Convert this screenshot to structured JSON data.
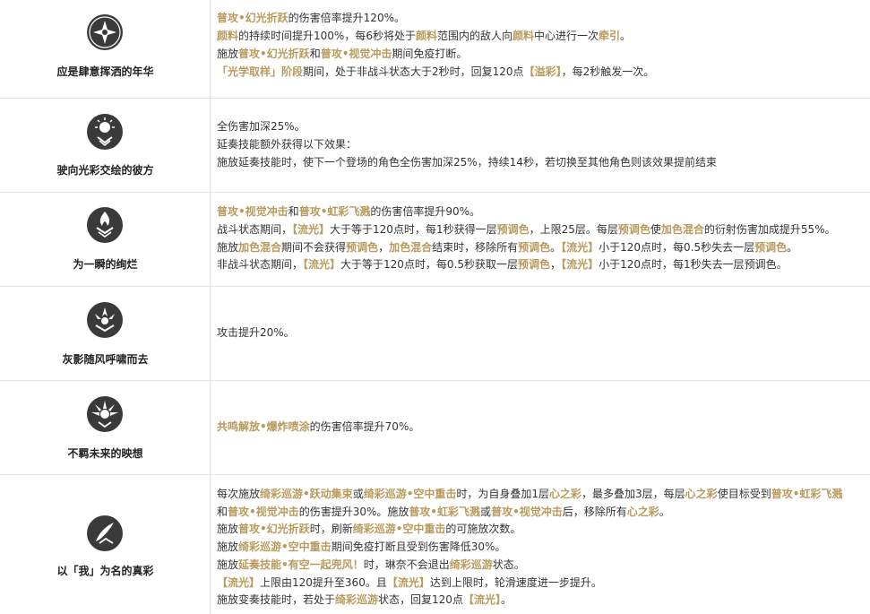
{
  "accent_color": "#b99a5c",
  "rows": [
    {
      "name": "应是肆意挥洒的年华",
      "icon": "radiant-star-icon",
      "lines": [
        [
          [
            "普攻•幻光折跃",
            1
          ],
          [
            "的伤害倍率提升120%。",
            0
          ]
        ],
        [
          [
            "颜料",
            1
          ],
          [
            "的持续时间提升100%，每6秒将处于",
            0
          ],
          [
            "颜料",
            1
          ],
          [
            "范围内的敌人向",
            0
          ],
          [
            "颜料",
            1
          ],
          [
            "中心进行一次",
            0
          ],
          [
            "牵引",
            1
          ],
          [
            "。",
            0
          ]
        ],
        [
          [
            "施放",
            0
          ],
          [
            "普攻•幻光折跃",
            1
          ],
          [
            "和",
            0
          ],
          [
            "普攻•视觉冲击",
            1
          ],
          [
            "期间免疫打断。",
            0
          ]
        ],
        [
          [
            "「光学取样」阶段",
            1
          ],
          [
            "期间，处于非战斗状态大于2秒时，回复120点",
            0
          ],
          [
            "【溢彩】",
            1
          ],
          [
            "，每2秒触发一次。",
            0
          ]
        ]
      ]
    },
    {
      "name": "驶向光彩交绘的彼方",
      "icon": "sun-chevron-icon",
      "lines": [
        [
          [
            "全伤害加深25%。",
            0
          ]
        ],
        [
          [
            "延奏技能额外获得以下效果：",
            0
          ]
        ],
        [
          [
            "施放延奏技能时，使下一个登场的角色全伤害加深25%，持续14秒，若切换至其他角色则该效果提前结束",
            0
          ]
        ]
      ]
    },
    {
      "name": "为一瞬的绚烂",
      "icon": "flame-chevron-icon",
      "lines": [
        [
          [
            "普攻•视觉冲击",
            1
          ],
          [
            "和",
            0
          ],
          [
            "普攻•虹彩飞溅",
            1
          ],
          [
            "的伤害倍率提升90%。",
            0
          ]
        ],
        [
          [
            "战斗状态期间，",
            0
          ],
          [
            "【流光】",
            1
          ],
          [
            "大于等于120点时，每1秒获得一层",
            0
          ],
          [
            "预调色",
            1
          ],
          [
            "，上限25层。每层",
            0
          ],
          [
            "预调色",
            1
          ],
          [
            "使",
            0
          ],
          [
            "加色混合",
            1
          ],
          [
            "的衍射伤害加成提升55%。",
            0
          ]
        ],
        [
          [
            "施放",
            0
          ],
          [
            "加色混合",
            1
          ],
          [
            "期间不会获得",
            0
          ],
          [
            "预调色",
            1
          ],
          [
            "，",
            0
          ],
          [
            "加色混合",
            1
          ],
          [
            "结束时，移除所有",
            0
          ],
          [
            "预调色",
            1
          ],
          [
            "。",
            0
          ],
          [
            "【流光】",
            1
          ],
          [
            "小于120点时，每0.5秒失去一层",
            0
          ],
          [
            "预调色",
            1
          ],
          [
            "。",
            0
          ]
        ],
        [
          [
            "非战斗状态期间，",
            0
          ],
          [
            "【流光】",
            1
          ],
          [
            "大于等于120点时，每0.5秒获取一层",
            0
          ],
          [
            "预调色",
            1
          ],
          [
            "，",
            0
          ],
          [
            "【流光】",
            1
          ],
          [
            "小于120点时，每1秒失去一层预调色。",
            0
          ]
        ]
      ]
    },
    {
      "name": "灰影随风呼啸而去",
      "icon": "crown-burst-icon",
      "lines": [
        [
          [
            "攻击提升20%。",
            0
          ]
        ]
      ]
    },
    {
      "name": "不羁未来的映想",
      "icon": "winged-sun-icon",
      "lines": [
        [
          [
            "共鸣解放•爆炸喷涂",
            1
          ],
          [
            "的伤害倍率提升70%。",
            0
          ]
        ]
      ]
    },
    {
      "name": "以「我」为名的真彩",
      "icon": "brush-stroke-icon",
      "lines": [
        [
          [
            "每次施放",
            0
          ],
          [
            "绮彩巡游•跃动集束",
            1
          ],
          [
            "或",
            0
          ],
          [
            "绮彩巡游•空中重击",
            1
          ],
          [
            "时，为自身叠加1层",
            0
          ],
          [
            "心之彩",
            1
          ],
          [
            "，最多叠加3层，每层",
            0
          ],
          [
            "心之彩",
            1
          ],
          [
            "使目标受到",
            0
          ],
          [
            "普攻•虹彩飞溅",
            1
          ]
        ],
        [
          [
            "和",
            0
          ],
          [
            "普攻•视觉冲击",
            1
          ],
          [
            "的伤害提升30%。施放",
            0
          ],
          [
            "普攻•虹彩飞溅",
            1
          ],
          [
            "或",
            0
          ],
          [
            "普攻•视觉冲击",
            1
          ],
          [
            "后，移除所有",
            0
          ],
          [
            "心之彩",
            1
          ],
          [
            "。",
            0
          ]
        ],
        [
          [
            "施放",
            0
          ],
          [
            "普攻•幻光折跃",
            1
          ],
          [
            "时，刷新",
            0
          ],
          [
            "绮彩巡游•空中重击",
            1
          ],
          [
            "的可施放次数。",
            0
          ]
        ],
        [
          [
            "施放",
            0
          ],
          [
            "绮彩巡游•空中重击",
            1
          ],
          [
            "期间免疫打断且受到伤害降低30%。",
            0
          ]
        ],
        [
          [
            "施放",
            0
          ],
          [
            "延奏技能•有空一起兜风！",
            1
          ],
          [
            "时，琳奈不会退出",
            0
          ],
          [
            "绮彩巡游",
            1
          ],
          [
            "状态。",
            0
          ]
        ],
        [
          [
            "【流光】",
            1
          ],
          [
            "上限由120提升至360。且",
            0
          ],
          [
            "【流光】",
            1
          ],
          [
            "达到上限时，轮滑速度进一步提升。",
            0
          ]
        ],
        [
          [
            "施放变奏技能时，若处于",
            0
          ],
          [
            "绮彩巡游",
            1
          ],
          [
            "状态，回复120点",
            0
          ],
          [
            "【流光】",
            1
          ],
          [
            "。",
            0
          ]
        ]
      ]
    }
  ]
}
